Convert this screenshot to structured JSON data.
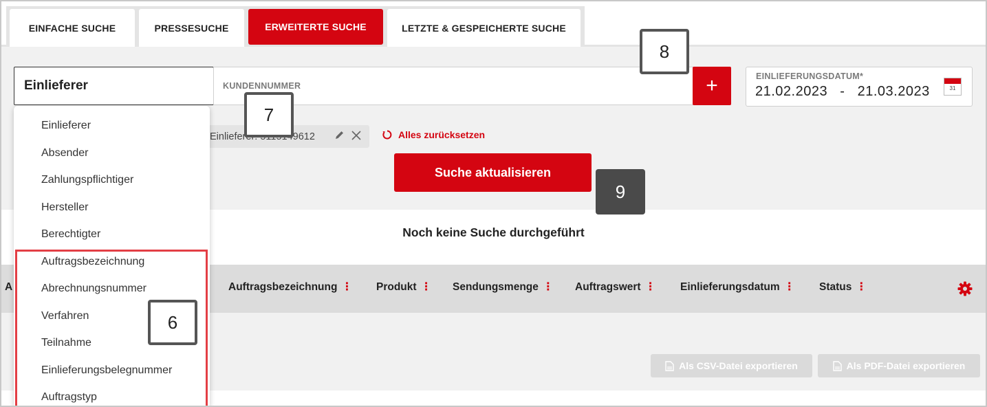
{
  "tabs": [
    {
      "label": "EINFACHE SUCHE",
      "active": false
    },
    {
      "label": "PRESSESUCHE",
      "active": false
    },
    {
      "label": "ERWEITERTE SUCHE",
      "active": true
    },
    {
      "label": "LETZTE & GESPEICHERTE SUCHE",
      "active": false
    }
  ],
  "search": {
    "field_selected": "Einlieferer",
    "input_placeholder": "KUNDENNUMMER",
    "add_label": "+"
  },
  "date": {
    "label": "EINLIEFERUNGSDATUM*",
    "from": "21.02.2023",
    "separator": "-",
    "to": "21.03.2023",
    "calendar_day": "31"
  },
  "chip": {
    "text": "Einlieferer: 5115149612"
  },
  "reset_label": "Alles zurücksetzen",
  "update_button": "Suche aktualisieren",
  "results": {
    "empty_message": "Noch keine Suche durchgeführt"
  },
  "table_headers": [
    "Auftragsbezeichnung",
    "Produkt",
    "Sendungsmenge",
    "Auftragswert",
    "Einlieferungsdatum",
    "Status"
  ],
  "table_header_partial": "A",
  "export": {
    "csv_label": "Als CSV-Datei exportieren",
    "pdf_label": "Als PDF-Datei exportieren"
  },
  "dropdown_options": [
    "Einlieferer",
    "Absender",
    "Zahlungspflichtiger",
    "Hersteller",
    "Berechtigter",
    "Auftragsbezeichnung",
    "Abrechnungsnummer",
    "Verfahren",
    "Teilnahme",
    "Einlieferungsbelegnummer",
    "Auftragstyp"
  ],
  "callouts": {
    "six": "6",
    "seven": "7",
    "eight": "8",
    "nine": "9"
  },
  "colors": {
    "brand_red": "#d40511",
    "highlight_red": "#e33e45",
    "callout_dark": "#4a4a4a"
  },
  "icons": [
    "plus-icon",
    "calendar-icon",
    "pencil-icon",
    "close-icon",
    "reset-icon",
    "more-vertical-icon",
    "gear-icon",
    "file-icon"
  ]
}
